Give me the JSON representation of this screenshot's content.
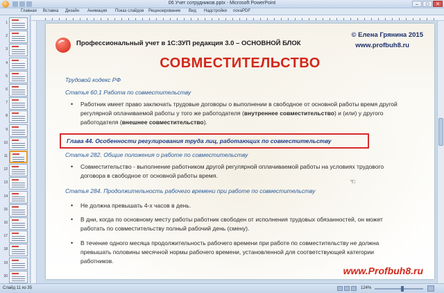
{
  "window": {
    "title": "06 Учет сотрудников.pptx - Microsoft PowerPoint",
    "min": "–",
    "max": "□",
    "close": "✕"
  },
  "ribbon": {
    "tabs": [
      "Главная",
      "Вставка",
      "Дизайн",
      "Анимация",
      "Показ слайдов",
      "Рецензирование",
      "Вид",
      "Надстройки",
      "novaPDF"
    ]
  },
  "thumbnails": {
    "numbers": [
      "1",
      "2",
      "3",
      "4",
      "5",
      "6",
      "7",
      "8",
      "9",
      "10",
      "11",
      "12",
      "13",
      "14",
      "15",
      "16",
      "17",
      "18",
      "19",
      "20"
    ],
    "active_index": 10
  },
  "slide": {
    "header_title": "Профессиональный учет в 1С:ЗУП редакция 3.0 – ОСНОВНОЙ БЛОК",
    "author": "© Елена Грянина 2015",
    "site": "www.profbuh8.ru",
    "main_title": "СОВМЕСТИТЕЛЬСТВО",
    "sec1": "Трудовой кодекс РФ",
    "sec2": "Статья 60.1 Работа по совместительству",
    "b1_l1": "Работник имеет право заключать трудовые договоры о выполнении в свободное от основной работы время другой",
    "b1_l2a": "регулярной оплачиваемой работы у того же работодателя (",
    "b1_l2b": "внутреннее совместительство",
    "b1_l2c": ") и (или) у другого",
    "b1_l3a": "работодателя (",
    "b1_l3b": "внешнее совместительство",
    "b1_l3c": ").",
    "chapter": "Глава 44. Особенности регулирования труда лиц, работающих по совместительству",
    "sec3": "Статья 282. Общие положения о работе по совместительству",
    "b2_l1": "Совместительство - выполнение работником другой регулярной оплачиваемой работы на условиях трудового",
    "b2_l2": "договора в свободное от основной работы время.",
    "sec4": "Статья 284. Продолжительность рабочего времени при работе по совместительству",
    "b3": "Не должна превышать 4-х часов в день.",
    "b4_l1": "В дни, когда по основному месту работы работник свободен от исполнения трудовых обязанностей, он может",
    "b4_l2": "работать по совместительству полный рабочий день (смену).",
    "b5_l1": "В течение одного месяца продолжительность рабочего времени при работе по совместительству не должна",
    "b5_l2": "превышать половины месячной нормы рабочего времени, установленной для соответствующей категории",
    "b5_l3": "работников.",
    "footer_site": "www.Profbuh8.ru",
    "bullet_char": "•"
  },
  "status": {
    "slide_info": "Слайд 11 из 35",
    "zoom": "124%"
  },
  "colors": {
    "title_red": "#d2271a",
    "section_blue": "#2a5a9a",
    "highlight_border": "#d62a2a"
  }
}
